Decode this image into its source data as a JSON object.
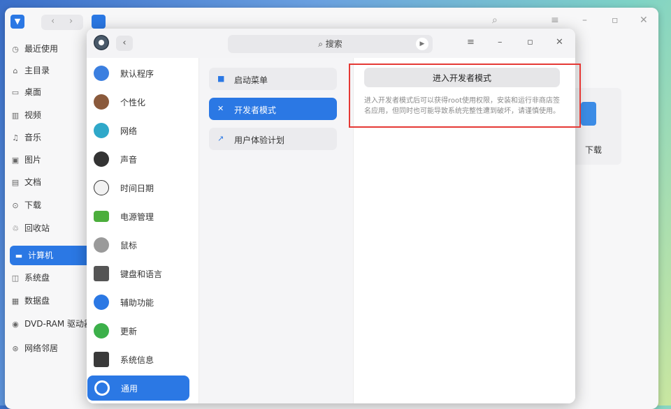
{
  "file_manager": {
    "sidebar": [
      {
        "icon": "clock-icon",
        "glyph": "◷",
        "label": "最近使用"
      },
      {
        "icon": "home-icon",
        "glyph": "⌂",
        "label": "主目录"
      },
      {
        "icon": "desktop-icon",
        "glyph": "▭",
        "label": "桌面"
      },
      {
        "icon": "video-icon",
        "glyph": "▥",
        "label": "视频"
      },
      {
        "icon": "music-icon",
        "glyph": "♫",
        "label": "音乐"
      },
      {
        "icon": "picture-icon",
        "glyph": "▣",
        "label": "图片"
      },
      {
        "icon": "document-icon",
        "glyph": "▤",
        "label": "文档"
      },
      {
        "icon": "download-icon",
        "glyph": "⊙",
        "label": "下载"
      },
      {
        "icon": "trash-icon",
        "glyph": "♲",
        "label": "回收站"
      },
      {
        "icon": "computer-icon",
        "glyph": "▬",
        "label": "计算机"
      },
      {
        "icon": "disk-icon",
        "glyph": "◫",
        "label": "系统盘"
      },
      {
        "icon": "disk-icon",
        "glyph": "▦",
        "label": "数据盘"
      },
      {
        "icon": "dvd-icon",
        "glyph": "◉",
        "label": "DVD-RAM 驱动器"
      },
      {
        "icon": "network-icon",
        "glyph": "⊛",
        "label": "网络邻居"
      }
    ],
    "folder_label": "下载"
  },
  "settings": {
    "search_placeholder": "搜索",
    "modules": [
      {
        "label": "默认程序",
        "color": "#3b7fe0"
      },
      {
        "label": "个性化",
        "color": "#8a5a3c"
      },
      {
        "label": "网络",
        "color": "#2fa8c9"
      },
      {
        "label": "声音",
        "color": "#333333"
      },
      {
        "label": "时间日期",
        "color": "#f2f2f2"
      },
      {
        "label": "电源管理",
        "color": "#4cae3c"
      },
      {
        "label": "鼠标",
        "color": "#9a9a9a"
      },
      {
        "label": "键盘和语言",
        "color": "#555555"
      },
      {
        "label": "辅助功能",
        "color": "#2b78e4"
      },
      {
        "label": "更新",
        "color": "#3cb04a"
      },
      {
        "label": "系统信息",
        "color": "#3a3a3a"
      },
      {
        "label": "通用",
        "color": "#ffffff"
      }
    ],
    "submenu": [
      {
        "icon": "menu-icon",
        "glyph": "■",
        "label": "启动菜单"
      },
      {
        "icon": "tools-icon",
        "glyph": "✕",
        "label": "开发者模式"
      },
      {
        "icon": "chart-icon",
        "glyph": "↗",
        "label": "用户体验计划"
      }
    ],
    "developer": {
      "button": "进入开发者模式",
      "description": "进入开发者模式后可以获得root使用权限，安装和运行非商店签名应用，但同时也可能导致系统完整性遭到破坏，请谨慎使用。"
    }
  },
  "colors": {
    "accent": "#2b78e4",
    "highlight": "#e53935"
  }
}
